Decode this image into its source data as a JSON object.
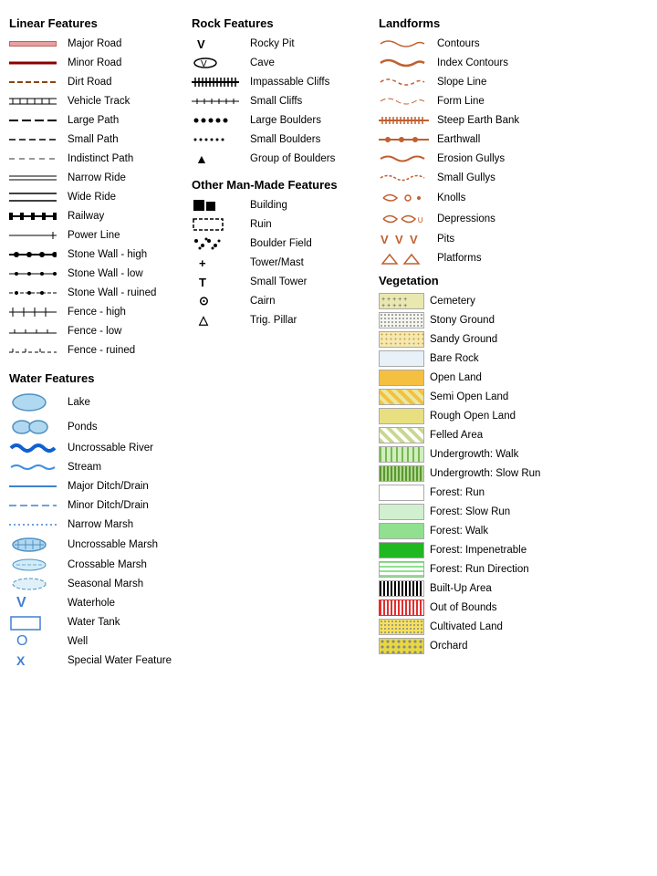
{
  "sections": {
    "linear": {
      "title": "Linear Features",
      "items": [
        {
          "label": "Major Road"
        },
        {
          "label": "Minor Road"
        },
        {
          "label": "Dirt Road"
        },
        {
          "label": "Vehicle Track"
        },
        {
          "label": "Large Path"
        },
        {
          "label": "Small Path"
        },
        {
          "label": "Indistinct Path"
        },
        {
          "label": "Narrow Ride"
        },
        {
          "label": "Wide Ride"
        },
        {
          "label": "Railway"
        },
        {
          "label": "Power Line"
        },
        {
          "label": "Stone Wall - high"
        },
        {
          "label": "Stone Wall - low"
        },
        {
          "label": "Stone Wall - ruined"
        },
        {
          "label": "Fence - high"
        },
        {
          "label": "Fence - low"
        },
        {
          "label": "Fence - ruined"
        }
      ]
    },
    "water": {
      "title": "Water Features",
      "items": [
        {
          "label": "Lake"
        },
        {
          "label": "Ponds"
        },
        {
          "label": "Uncrossable River"
        },
        {
          "label": "Stream"
        },
        {
          "label": "Major Ditch/Drain"
        },
        {
          "label": "Minor Ditch/Drain"
        },
        {
          "label": "Narrow Marsh"
        },
        {
          "label": "Uncrossable Marsh"
        },
        {
          "label": "Crossable Marsh"
        },
        {
          "label": "Seasonal Marsh"
        },
        {
          "label": "Waterhole"
        },
        {
          "label": "Water Tank"
        },
        {
          "label": "Well"
        },
        {
          "label": "Special Water Feature"
        }
      ]
    },
    "rock": {
      "title": "Rock Features",
      "items": [
        {
          "label": "Rocky Pit",
          "symbol": "V"
        },
        {
          "label": "Cave"
        },
        {
          "label": "Impassable Cliffs"
        },
        {
          "label": "Small Cliffs"
        },
        {
          "label": "Large Boulders"
        },
        {
          "label": "Small Boulders"
        },
        {
          "label": "Group of Boulders",
          "symbol": "▲"
        }
      ]
    },
    "manmade": {
      "title": "Other Man-Made Features",
      "items": [
        {
          "label": "Building"
        },
        {
          "label": "Ruin"
        },
        {
          "label": "Boulder Field"
        },
        {
          "label": "Tower/Mast",
          "symbol": "+"
        },
        {
          "label": "Small Tower",
          "symbol": "T"
        },
        {
          "label": "Cairn",
          "symbol": "⊙"
        },
        {
          "label": "Trig. Pillar",
          "symbol": "△"
        }
      ]
    },
    "landforms": {
      "title": "Landforms",
      "items": [
        {
          "label": "Contours"
        },
        {
          "label": "Index Contours"
        },
        {
          "label": "Slope Line"
        },
        {
          "label": "Form Line"
        },
        {
          "label": "Steep Earth Bank"
        },
        {
          "label": "Earthwall"
        },
        {
          "label": "Erosion Gullys"
        },
        {
          "label": "Small Gullys"
        },
        {
          "label": "Knolls"
        },
        {
          "label": "Depressions"
        },
        {
          "label": "Pits"
        },
        {
          "label": "Platforms"
        }
      ]
    },
    "vegetation": {
      "title": "Vegetation",
      "items": [
        {
          "label": "Cemetery"
        },
        {
          "label": "Stony Ground"
        },
        {
          "label": "Sandy Ground"
        },
        {
          "label": "Bare Rock"
        },
        {
          "label": "Open Land"
        },
        {
          "label": "Semi Open Land"
        },
        {
          "label": "Rough Open Land"
        },
        {
          "label": "Felled Area"
        },
        {
          "label": "Undergrowth: Walk"
        },
        {
          "label": "Undergrowth: Slow Run"
        },
        {
          "label": "Forest: Run"
        },
        {
          "label": "Forest: Slow Run"
        },
        {
          "label": "Forest: Walk"
        },
        {
          "label": "Forest: Impenetrable"
        },
        {
          "label": "Forest: Run Direction"
        },
        {
          "label": "Built-Up Area"
        },
        {
          "label": "Out of Bounds"
        },
        {
          "label": "Cultivated Land"
        },
        {
          "label": "Orchard"
        }
      ]
    }
  }
}
